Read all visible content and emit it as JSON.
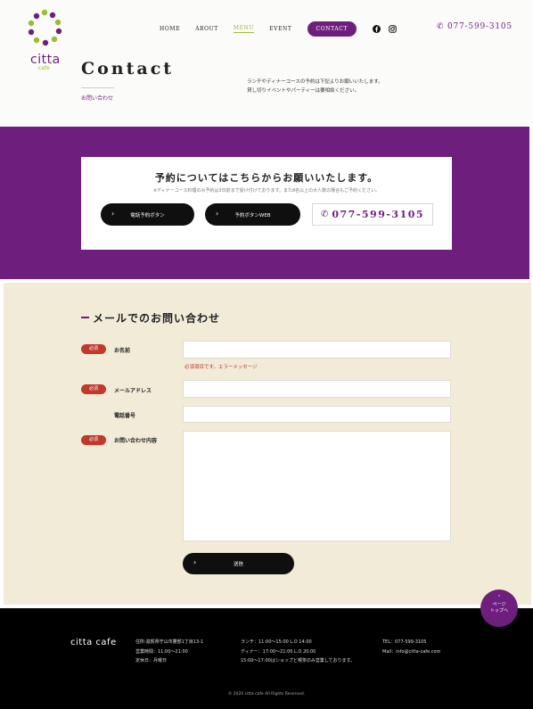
{
  "brand": {
    "name": "citta",
    "sub": "cafe",
    "colors": {
      "purple": "#6e1f7e",
      "green": "#9bbd2e",
      "cream": "#f1ebd8",
      "error": "#c0392b"
    }
  },
  "nav": {
    "items": [
      "HOME",
      "ABOUT",
      "MENU",
      "EVENT"
    ],
    "contact": "CONTACT",
    "icons": [
      "facebook-icon",
      "instagram-icon"
    ],
    "tel": "077-599-3105"
  },
  "hero": {
    "title": "Contact",
    "subtitle": "お問い合わせ",
    "intro_line1": "ランチやディナーコースの予約は下記よりお願いいたします。",
    "intro_line2": "貸し切りイベントやパーティーは要相談ください。"
  },
  "reservation": {
    "title": "予約についてはこちらからお願いいたします。",
    "note": "※ディナーコース料理のみ予約は3日前まで受け付けております。また8名以上の大人数の場合もご予約ください。",
    "phone_button": "電話予約ボタン",
    "web_button": "予約ボタンWEB",
    "tel": "077-599-3105"
  },
  "form": {
    "heading": "メールでのお問い合わせ",
    "required_badge": "必須",
    "name_label": "お名前",
    "error_message": "必須項目です。エラーメッセージ",
    "email_label": "メールアドレス",
    "phone_label": "電話番号",
    "message_label": "お問い合わせ内容",
    "submit": "送信"
  },
  "footer": {
    "logo": "citta cafe",
    "address": "住所:滋賀県守山市勝部1丁目13-1",
    "hours": "営業時間：11:00〜21:00",
    "closed": "定休日：月曜日",
    "lunch": "ランチ：11:00〜15:00 L.O 14:00",
    "dinner": "ディナー：17:00〜21:00 L.O 20:00",
    "shop_note": "15:00〜17:00はショップと喫茶のみ営業しております。",
    "tel": "TEL：077-599-3105",
    "mail": "Mail：info@citta-cafe.com",
    "copyright": "© 2020 citta cafe All Rights Reserved."
  },
  "pagetop": {
    "line1": "ページ",
    "line2": "トップへ"
  }
}
